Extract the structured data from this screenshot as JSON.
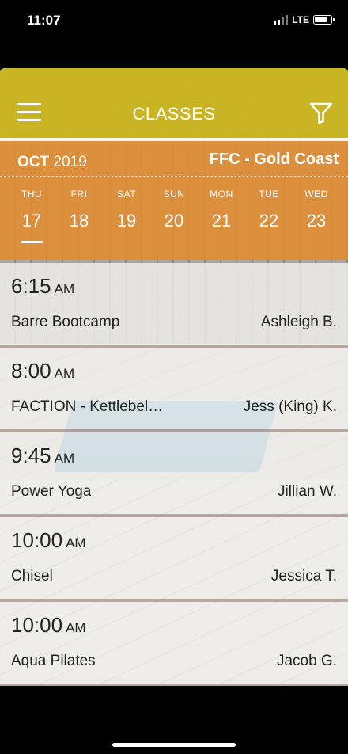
{
  "status": {
    "time": "11:07",
    "network": "LTE"
  },
  "header": {
    "title": "CLASSES"
  },
  "datebar": {
    "month": "OCT",
    "year": "2019",
    "location": "FFC - Gold Coast",
    "days": [
      {
        "name": "THU",
        "num": "17",
        "selected": true
      },
      {
        "name": "FRI",
        "num": "18"
      },
      {
        "name": "SAT",
        "num": "19"
      },
      {
        "name": "SUN",
        "num": "20"
      },
      {
        "name": "MON",
        "num": "21"
      },
      {
        "name": "TUE",
        "num": "22"
      },
      {
        "name": "WED",
        "num": "23"
      }
    ]
  },
  "classes": [
    {
      "time": "6:15",
      "ampm": "AM",
      "name": "Barre Bootcamp",
      "instructor": "Ashleigh B."
    },
    {
      "time": "8:00",
      "ampm": "AM",
      "name": "FACTION - Kettlebel…",
      "instructor": "Jess (King) K."
    },
    {
      "time": "9:45",
      "ampm": "AM",
      "name": "Power Yoga",
      "instructor": "Jillian W."
    },
    {
      "time": "10:00",
      "ampm": "AM",
      "name": "Chisel",
      "instructor": "Jessica T."
    },
    {
      "time": "10:00",
      "ampm": "AM",
      "name": "Aqua Pilates",
      "instructor": "Jacob G."
    }
  ],
  "colors": {
    "header": "#c8b21a",
    "datebar": "#e28c30"
  }
}
